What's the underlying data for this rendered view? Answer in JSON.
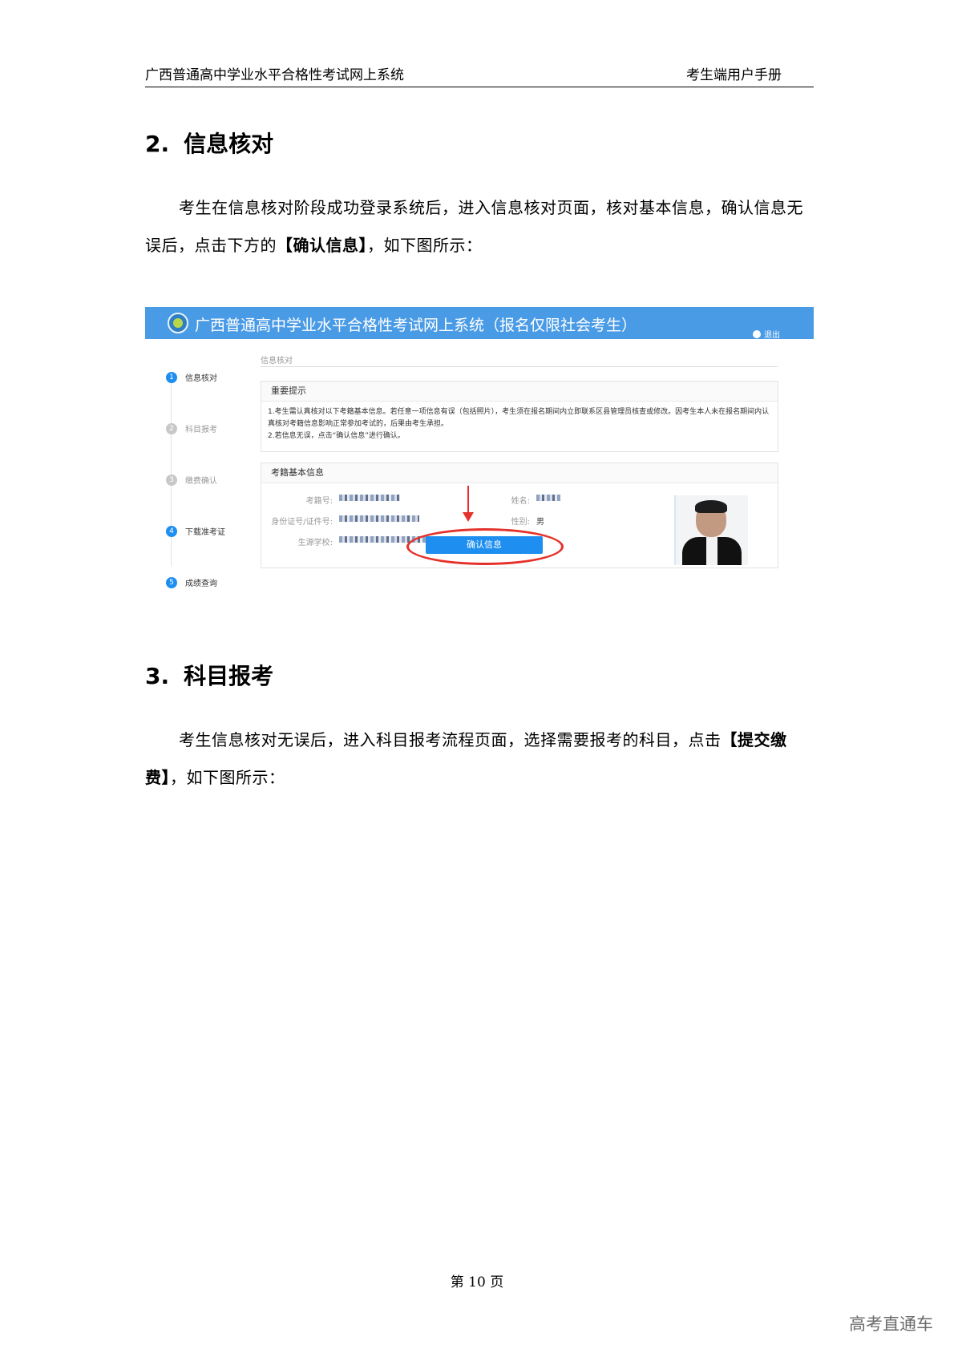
{
  "header": {
    "system_name": "广西普通高中学业水平合格性考试网上系统",
    "doc_name": "考生端用户手册"
  },
  "sections": [
    {
      "number": "2.",
      "title": "信息核对",
      "para_before": "考生在信息核对阶段成功登录系统后，进入信息核对页面，核对基本信息，确认信息无误后，点击下方的",
      "para_bold": "【确认信息】",
      "para_after": "，如下图所示："
    },
    {
      "number": "3.",
      "title": "科目报考",
      "para_before": "考生信息核对无误后，进入科目报考流程页面，选择需要报考的科目，点击",
      "para_bold": "【提交缴费】",
      "para_after": "，如下图所示："
    }
  ],
  "screenshot": {
    "app_title": "广西普通高中学业水平合格性考试网上系统（报名仅限社会考生）",
    "logout_label": "退出",
    "steps": [
      {
        "num": "1",
        "label": "信息核对",
        "active": true
      },
      {
        "num": "2",
        "label": "科目报考",
        "active": false
      },
      {
        "num": "3",
        "label": "缴费确认",
        "active": false
      },
      {
        "num": "4",
        "label": "下载准考证",
        "active": true
      },
      {
        "num": "5",
        "label": "成绩查询",
        "active": true
      }
    ],
    "breadcrumb": "信息核对",
    "notice": {
      "title": "重要提示",
      "line1": "1.考生需认真核对以下考籍基本信息。若任意一项信息有误（包括照片），考生须在报名期间内立即联系区县管理员核查或修改。因考生本人未在报名期间内认真核对考籍信息影响正常参加考试的，后果由考生承担。",
      "line2": "2.若信息无误，点击“确认信息”进行确认。"
    },
    "info": {
      "title": "考籍基本信息",
      "exam_no_label": "考籍号:",
      "name_label": "姓名:",
      "id_label": "身份证号/证件号:",
      "gender_label": "性别:",
      "gender_value": "男",
      "school_label": "生源学校:"
    },
    "confirm_button": "确认信息"
  },
  "footer": {
    "page_label": "第 10 页"
  },
  "watermark": "高考直通车",
  "colors": {
    "app_bar": "#4a9be6",
    "primary_button": "#1e8ff0",
    "annotation_red": "#e5312a"
  }
}
